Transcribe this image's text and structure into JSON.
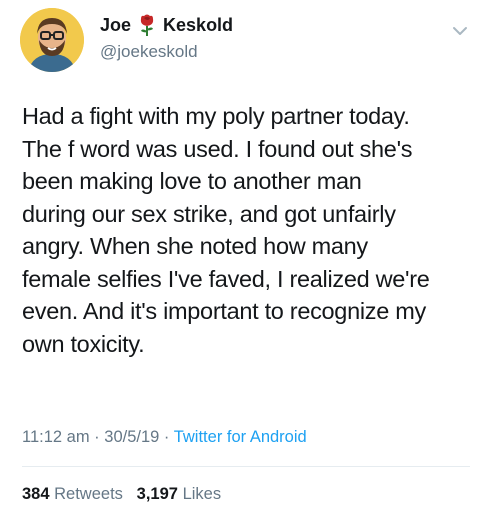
{
  "user": {
    "first_name": "Joe",
    "last_name": "Keskold",
    "name_emoji": "rose-icon",
    "handle": "@joekeskold"
  },
  "tweet": {
    "text": "Had a fight with my poly partner today.\nThe f word was used. I found out she's\nbeen making love to another man\nduring our sex strike, and got unfairly\nangry. When she noted how many\nfemale selfies I've faved, I realized we're\neven. And it's important to recognize my\nown toxicity.",
    "time": "11:12 am",
    "separator": "·",
    "date": "30/5/19",
    "source": "Twitter for Android"
  },
  "stats": {
    "retweets_count": "384",
    "retweets_label": "Retweets",
    "likes_count": "3,197",
    "likes_label": "Likes"
  },
  "colors": {
    "text": "#14171a",
    "secondary": "#657786",
    "link": "#1da1f2",
    "divider": "#e6ecf0",
    "avatar_bg": "#f2c94c"
  }
}
